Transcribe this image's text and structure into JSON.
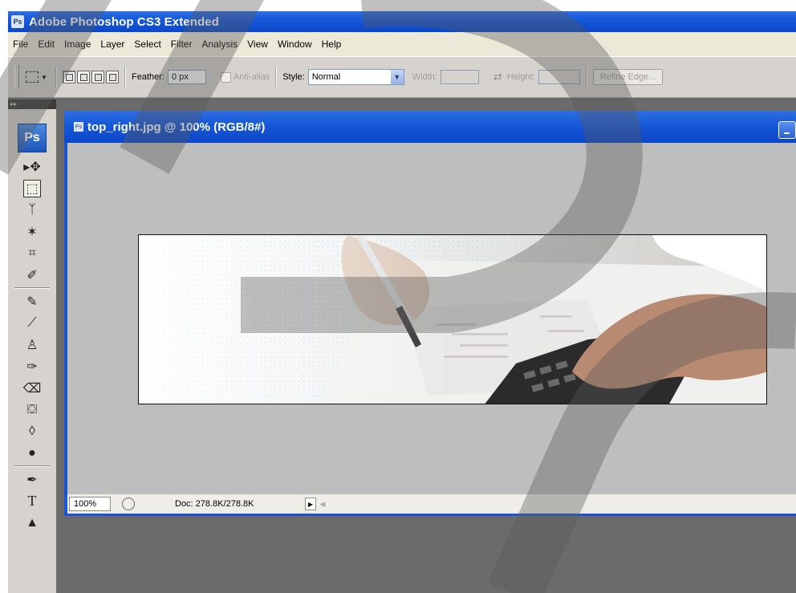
{
  "app": {
    "title": "Adobe Photoshop CS3 Extended",
    "logo": "Ps",
    "doc_icon_text": "Ps"
  },
  "menu": [
    "File",
    "Edit",
    "Image",
    "Layer",
    "Select",
    "Filter",
    "Analysis",
    "View",
    "Window",
    "Help"
  ],
  "options": {
    "feather_label": "Feather:",
    "feather_value": "0 px",
    "antialias_label": "Anti-alias",
    "style_label": "Style:",
    "style_value": "Normal",
    "width_label": "Width:",
    "height_label": "Height:",
    "refine_label": "Refine Edge..."
  },
  "toolbox": {
    "collapse_glyph": "▸▸",
    "tools": [
      {
        "name": "move-tool-icon",
        "glyph": "▸✥"
      },
      {
        "name": "rectangular-marquee-tool-icon",
        "glyph": "⬚",
        "selected": true
      },
      {
        "name": "lasso-tool-icon",
        "glyph": "ᛉ"
      },
      {
        "name": "magic-wand-tool-icon",
        "glyph": "✶"
      },
      {
        "name": "crop-tool-icon",
        "glyph": "⌗"
      },
      {
        "name": "slice-tool-icon",
        "glyph": "✐"
      },
      {
        "name": "healing-brush-tool-icon",
        "glyph": "✎"
      },
      {
        "name": "brush-tool-icon",
        "glyph": "⟋"
      },
      {
        "name": "clone-stamp-tool-icon",
        "glyph": "♙"
      },
      {
        "name": "history-brush-tool-icon",
        "glyph": "✑"
      },
      {
        "name": "eraser-tool-icon",
        "glyph": "⌫"
      },
      {
        "name": "paint-bucket-tool-icon",
        "glyph": "⛋"
      },
      {
        "name": "blur-tool-icon",
        "glyph": "◊"
      },
      {
        "name": "dodge-tool-icon",
        "glyph": "●"
      },
      {
        "name": "pen-tool-icon",
        "glyph": "✒"
      },
      {
        "name": "type-tool-icon",
        "glyph": "T"
      },
      {
        "name": "path-selection-tool-icon",
        "glyph": "▲"
      }
    ]
  },
  "document": {
    "title": "top_right.jpg @ 100% (RGB/8#)",
    "zoom": "100%",
    "doc_info": "Doc: 278.8K/278.8K",
    "play_glyph": "▶",
    "scroll_glyph": "◀"
  },
  "colors": {
    "title_blue": "#1658d8",
    "chrome": "#d6d3ce",
    "workspace": "#6b6b6b",
    "canvas": "#bebebe"
  }
}
